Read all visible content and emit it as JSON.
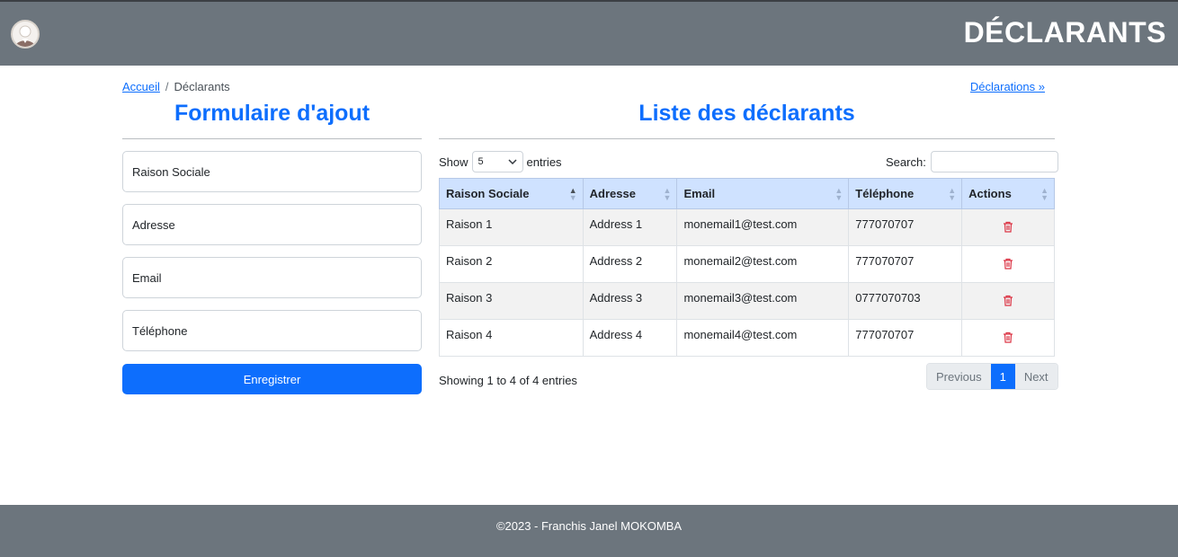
{
  "header": {
    "title": "DÉCLARANTS"
  },
  "breadcrumb": {
    "home": "Accueil",
    "separator": "/",
    "current": "Déclarants"
  },
  "next_link": "Déclarations »",
  "form": {
    "title": "Formulaire d'ajout",
    "fields": [
      "Raison Sociale",
      "Adresse",
      "Email",
      "Téléphone"
    ],
    "submit_label": "Enregistrer"
  },
  "list": {
    "title": "Liste des déclarants",
    "length": {
      "show": "Show",
      "value": "5",
      "entries": "entries"
    },
    "search_label": "Search:",
    "columns": [
      "Raison Sociale",
      "Adresse",
      "Email",
      "Téléphone",
      "Actions"
    ],
    "rows": [
      {
        "raison": "Raison 1",
        "adresse": "Address 1",
        "email": "monemail1@test.com",
        "tel": "777070707"
      },
      {
        "raison": "Raison 2",
        "adresse": "Address 2",
        "email": "monemail2@test.com",
        "tel": "777070707"
      },
      {
        "raison": "Raison 3",
        "adresse": "Address 3",
        "email": "monemail3@test.com",
        "tel": "0777070703"
      },
      {
        "raison": "Raison 4",
        "adresse": "Address 4",
        "email": "monemail4@test.com",
        "tel": "777070707"
      }
    ],
    "info": "Showing 1 to 4 of 4 entries",
    "pagination": {
      "previous": "Previous",
      "current": "1",
      "next": "Next"
    }
  },
  "icons": {
    "delete": "trash-icon",
    "avatar": "user-avatar"
  },
  "colors": {
    "accent": "#0d6efd",
    "header_bg": "#6c757d",
    "table_header_bg": "#cfe2ff",
    "danger": "#dc3545"
  },
  "footer": {
    "text": "©2023 - Franchis Janel MOKOMBA"
  }
}
